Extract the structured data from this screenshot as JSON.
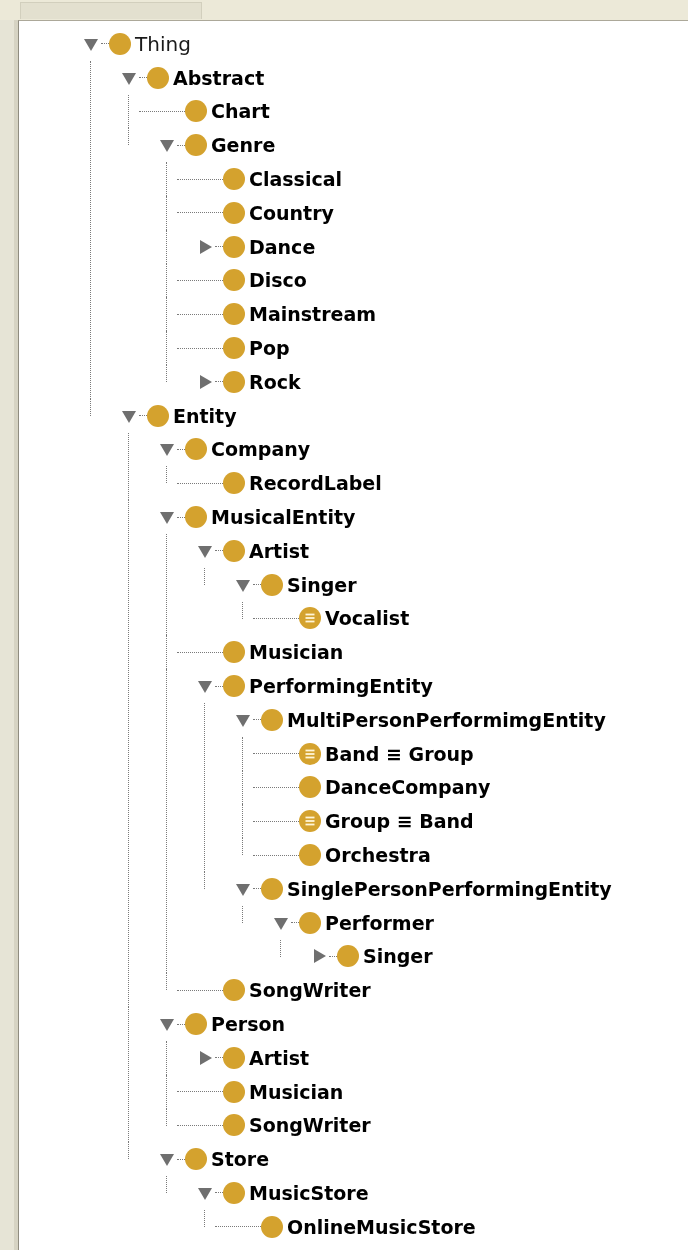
{
  "tree": [
    {
      "label": "Thing",
      "kind": "root",
      "expanded": true,
      "children": [
        {
          "label": "Abstract",
          "kind": "class",
          "expanded": true,
          "children": [
            {
              "label": "Chart",
              "kind": "class"
            },
            {
              "label": "Genre",
              "kind": "class",
              "expanded": true,
              "children": [
                {
                  "label": "Classical",
                  "kind": "class"
                },
                {
                  "label": "Country",
                  "kind": "class"
                },
                {
                  "label": "Dance",
                  "kind": "class",
                  "expanded": false
                },
                {
                  "label": "Disco",
                  "kind": "class"
                },
                {
                  "label": "Mainstream",
                  "kind": "class"
                },
                {
                  "label": "Pop",
                  "kind": "class"
                },
                {
                  "label": "Rock",
                  "kind": "class",
                  "expanded": false
                }
              ]
            }
          ]
        },
        {
          "label": "Entity",
          "kind": "class",
          "expanded": true,
          "children": [
            {
              "label": "Company",
              "kind": "class",
              "expanded": true,
              "children": [
                {
                  "label": "RecordLabel",
                  "kind": "class"
                }
              ]
            },
            {
              "label": "MusicalEntity",
              "kind": "class",
              "expanded": true,
              "children": [
                {
                  "label": "Artist",
                  "kind": "class",
                  "expanded": true,
                  "children": [
                    {
                      "label": "Singer",
                      "kind": "class",
                      "expanded": true,
                      "children": [
                        {
                          "label": "Vocalist",
                          "kind": "defined"
                        }
                      ]
                    }
                  ]
                },
                {
                  "label": "Musician",
                  "kind": "class"
                },
                {
                  "label": "PerformingEntity",
                  "kind": "class",
                  "expanded": true,
                  "children": [
                    {
                      "label": "MultiPersonPerformimgEntity",
                      "kind": "class",
                      "expanded": true,
                      "children": [
                        {
                          "label": "Band ≡ Group",
                          "kind": "defined"
                        },
                        {
                          "label": "DanceCompany",
                          "kind": "class"
                        },
                        {
                          "label": "Group ≡ Band",
                          "kind": "defined"
                        },
                        {
                          "label": "Orchestra",
                          "kind": "class"
                        }
                      ]
                    },
                    {
                      "label": "SinglePersonPerformingEntity",
                      "kind": "class",
                      "expanded": true,
                      "children": [
                        {
                          "label": "Performer",
                          "kind": "class",
                          "expanded": true,
                          "children": [
                            {
                              "label": "Singer",
                              "kind": "class",
                              "expanded": false
                            }
                          ]
                        }
                      ]
                    }
                  ]
                },
                {
                  "label": "SongWriter",
                  "kind": "class"
                }
              ]
            },
            {
              "label": "Person",
              "kind": "class",
              "expanded": true,
              "children": [
                {
                  "label": "Artist",
                  "kind": "class",
                  "expanded": false
                },
                {
                  "label": "Musician",
                  "kind": "class"
                },
                {
                  "label": "SongWriter",
                  "kind": "class"
                }
              ]
            },
            {
              "label": "Store",
              "kind": "class",
              "expanded": true,
              "children": [
                {
                  "label": "MusicStore",
                  "kind": "class",
                  "expanded": true,
                  "children": [
                    {
                      "label": "OnlineMusicStore",
                      "kind": "class"
                    }
                  ]
                }
              ]
            }
          ]
        }
      ]
    }
  ]
}
